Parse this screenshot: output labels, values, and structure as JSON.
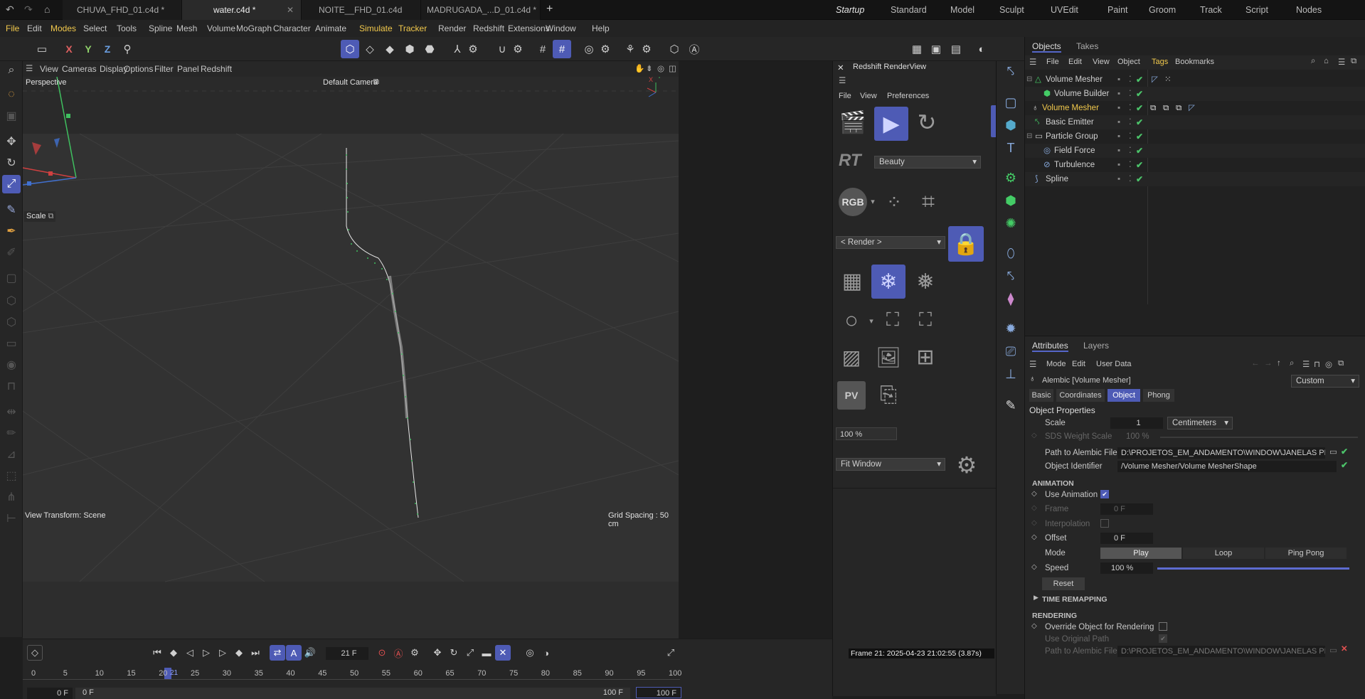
{
  "tabs": [
    {
      "label": "CHUVA_FHD_01.c4d *"
    },
    {
      "label": "water.c4d *"
    },
    {
      "label": "NOITE__FHD_01.c4d"
    },
    {
      "label": "MADRUGADA_...D_01.c4d *"
    }
  ],
  "layouts": [
    "Startup",
    "Standard",
    "Model",
    "Sculpt",
    "UVEdit",
    "Paint",
    "Groom",
    "Track",
    "Script",
    "Nodes"
  ],
  "menu": [
    "File",
    "Edit",
    "Modes",
    "Select",
    "Tools",
    "Spline",
    "Mesh",
    "Volume",
    "MoGraph",
    "Character",
    "Animate",
    "Simulate",
    "Tracker",
    "Render",
    "Redshift",
    "Extensions",
    "Window",
    "Help"
  ],
  "toolbar": {
    "x": "X",
    "y": "Y",
    "z": "Z"
  },
  "viewport": {
    "menu": [
      "View",
      "Cameras",
      "Display",
      "Options",
      "Filter",
      "Panel",
      "Redshift"
    ],
    "name": "Perspective",
    "camera": "Default Camera",
    "tool": "Scale",
    "view_transform": "View Transform: Scene",
    "grid_spacing": "Grid Spacing : 50 cm",
    "axis_x": "X",
    "axis_y": "Y"
  },
  "renderview": {
    "title": "Redshift RenderView",
    "menu": [
      "File",
      "View",
      "Preferences"
    ],
    "rt": "RT",
    "aov": "Beauty",
    "rgb": "RGB",
    "render_target": "< Render >",
    "zoom": "100 %",
    "fit": "Fit Window",
    "pv": "PV",
    "frame_info": "Frame  21:  2025-04-23  21:02:55  (3.87s)"
  },
  "objects": {
    "tabs": [
      "Objects",
      "Takes"
    ],
    "menu": [
      "File",
      "Edit",
      "View",
      "Object",
      "Tags",
      "Bookmarks"
    ],
    "rows": [
      {
        "name": "Volume Mesher"
      },
      {
        "name": "Volume Builder"
      },
      {
        "name": "Volume Mesher"
      },
      {
        "name": "Basic Emitter"
      },
      {
        "name": "Particle Group"
      },
      {
        "name": "Field Force"
      },
      {
        "name": "Turbulence"
      },
      {
        "name": "Spline"
      }
    ]
  },
  "attributes": {
    "tabs": [
      "Attributes",
      "Layers"
    ],
    "menu": [
      "Mode",
      "Edit",
      "User Data"
    ],
    "object_title": "Alembic [Volume Mesher]",
    "preset": "Custom",
    "subtabs": [
      "Basic",
      "Coordinates",
      "Object",
      "Phong"
    ],
    "section_title": "Object Properties",
    "scale_label": "Scale",
    "scale_value": "1",
    "scale_unit": "Centimeters",
    "sds_label": "SDS Weight Scale",
    "sds_value": "100 %",
    "path_label": "Path to Alembic File",
    "path_value": "D:\\PROJETOS_EM_ANDAMENTO\\WINDOW\\JANELAS PROJ",
    "identifier_label": "Object Identifier",
    "identifier_value": "/Volume Mesher/Volume MesherShape",
    "animation_header": "ANIMATION",
    "use_animation": "Use Animation",
    "frame_label": "Frame",
    "frame_value": "0 F",
    "interpolation": "Interpolation",
    "offset_label": "Offset",
    "offset_value": "0 F",
    "mode_label": "Mode",
    "mode_options": [
      "Play",
      "Loop",
      "Ping Pong"
    ],
    "speed_label": "Speed",
    "speed_value": "100 %",
    "speed_level": 1.0,
    "reset": "Reset",
    "time_remapping": "TIME REMAPPING",
    "rendering_header": "RENDERING",
    "override": "Override Object for Rendering",
    "use_original": "Use Original Path",
    "path2_label": "Path to Alembic File",
    "path2_value": "D:\\PROJETOS_EM_ANDAMENTO\\WINDOW\\JANELAS PROJ"
  },
  "timeline": {
    "current_frame": "21 F",
    "ticks": [
      "0",
      "5",
      "10",
      "15",
      "20",
      "25",
      "30",
      "35",
      "40",
      "45",
      "50",
      "55",
      "60",
      "65",
      "70",
      "75",
      "80",
      "85",
      "90",
      "95",
      "100"
    ],
    "playhead": "21",
    "start": "0 F",
    "min": "0 F",
    "max": "100 F",
    "end": "100 F"
  },
  "colors": {
    "accent": "#4e5bb5",
    "check": "#4cc46a",
    "highlight": "#f2c94c"
  }
}
